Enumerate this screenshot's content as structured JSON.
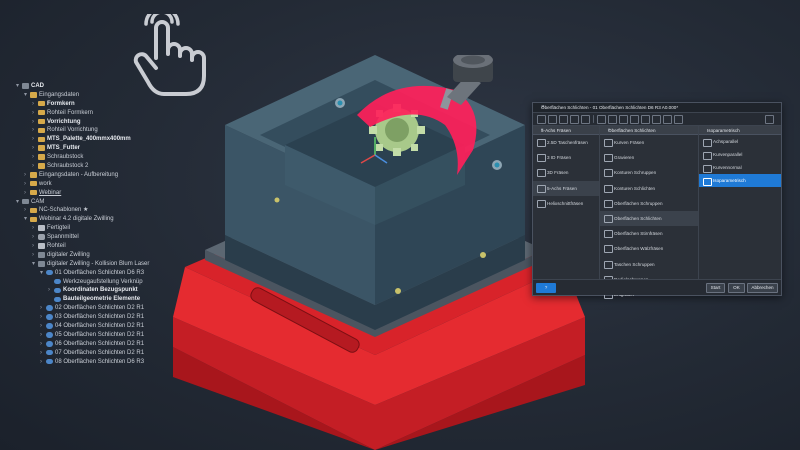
{
  "tree": {
    "rows": [
      {
        "caret": "▾",
        "indent": 0,
        "icon": "cam",
        "label": "CAD",
        "bold": true
      },
      {
        "caret": "▾",
        "indent": 1,
        "icon": "folder",
        "label": "Eingangsdaten"
      },
      {
        "caret": "›",
        "indent": 2,
        "icon": "folder",
        "label": "Formkern",
        "bold": true
      },
      {
        "caret": "›",
        "indent": 2,
        "icon": "folder",
        "label": "Rohteil Formkern"
      },
      {
        "caret": "›",
        "indent": 2,
        "icon": "folder",
        "label": "Vorrichtung",
        "bold": true
      },
      {
        "caret": "›",
        "indent": 2,
        "icon": "folder",
        "label": "Rohteil Vorrichtung"
      },
      {
        "caret": "›",
        "indent": 2,
        "icon": "folder",
        "label": "MTS_Palette_400mmx400mm",
        "bold": true
      },
      {
        "caret": "›",
        "indent": 2,
        "icon": "folder",
        "label": "MTS_Futter",
        "bold": true
      },
      {
        "caret": "›",
        "indent": 2,
        "icon": "folder",
        "label": "Schraubstock"
      },
      {
        "caret": "›",
        "indent": 2,
        "icon": "folder",
        "label": "Schraubstock 2"
      },
      {
        "caret": "›",
        "indent": 1,
        "icon": "folder",
        "label": "Eingangsdaten - Aufbereitung"
      },
      {
        "caret": "›",
        "indent": 1,
        "icon": "folder",
        "label": "work"
      },
      {
        "caret": "›",
        "indent": 1,
        "icon": "folder",
        "label": "Webinar",
        "underline": true
      },
      {
        "caret": "▾",
        "indent": 0,
        "icon": "cam",
        "label": "CAM"
      },
      {
        "caret": "›",
        "indent": 1,
        "icon": "folder",
        "label": "NC-Schablonen ★"
      },
      {
        "caret": "▾",
        "indent": 1,
        "icon": "folder",
        "label": "Webinar 4.2 digitale Zwilling"
      },
      {
        "caret": "›",
        "indent": 2,
        "icon": "part",
        "label": "Fertigteil"
      },
      {
        "caret": "›",
        "indent": 2,
        "icon": "cyl",
        "label": "Spannmittel"
      },
      {
        "caret": "›",
        "indent": 2,
        "icon": "part",
        "label": "Rohteil"
      },
      {
        "caret": "›",
        "indent": 2,
        "icon": "cam",
        "label": "digitaler Zwilling"
      },
      {
        "caret": "▾",
        "indent": 2,
        "icon": "cam",
        "label": "digitaler Zwilling - Kollision Blum Laser"
      },
      {
        "caret": "▾",
        "indent": 3,
        "icon": "op",
        "label": "01 Oberflächen Schlichten D6 R3"
      },
      {
        "caret": "",
        "indent": 4,
        "icon": "op",
        "label": "Werkzeugaufstellung Verknüp"
      },
      {
        "caret": "›",
        "indent": 4,
        "icon": "op",
        "label": "Koordinaten Bezugspunkt",
        "bold": true
      },
      {
        "caret": "",
        "indent": 4,
        "icon": "op",
        "label": "Bauteilgeometrie Elemente",
        "bold": true
      },
      {
        "caret": "›",
        "indent": 3,
        "icon": "op",
        "label": "02 Oberflächen Schlichten D2 R1"
      },
      {
        "caret": "›",
        "indent": 3,
        "icon": "op",
        "label": "03 Oberflächen Schlichten D2 R1"
      },
      {
        "caret": "›",
        "indent": 3,
        "icon": "op",
        "label": "04 Oberflächen Schlichten D2 R1"
      },
      {
        "caret": "›",
        "indent": 3,
        "icon": "op",
        "label": "05 Oberflächen Schlichten D2 R1"
      },
      {
        "caret": "›",
        "indent": 3,
        "icon": "op",
        "label": "06 Oberflächen Schlichten D2 R1"
      },
      {
        "caret": "›",
        "indent": 3,
        "icon": "op",
        "label": "07 Oberflächen Schlichten D2 R1"
      },
      {
        "caret": "›",
        "indent": 3,
        "icon": "op",
        "label": "08 Oberflächen Schlichten D6 R3"
      }
    ]
  },
  "dialog": {
    "title": "Oberflächen Schlichten - 01 Oberflächen Schlichten D6 R3 A0.000*",
    "close": "✕",
    "col1": {
      "header": "5-Achs Fräsen",
      "items": [
        "2.5D Taschenfräsen",
        "3 ID Fräsen",
        "3D Fräsen",
        "5-Achs Fräsen",
        "Helixschnittfräsen"
      ],
      "selected_index": 3
    },
    "col2": {
      "header": "Oberflächen Schlichten",
      "items": [
        "Kurven Fräsen",
        "Gravieren",
        "Konturen Schruppen",
        "Konturen Schlichten",
        "Oberflächen Schruppen",
        "Oberflächen Schlichten",
        "Oberflächen Stirnfräsen",
        "Oberflächen Wälzfräsen",
        "Taschen Schruppen",
        "Radialschruppen",
        "Entgraten"
      ],
      "selected_index": 5
    },
    "col3": {
      "header": "Isoparametrisch",
      "items": [
        "Achsparallel",
        "Kurvenparallel",
        "Kurvennormal",
        "Isoparametrisch"
      ],
      "selected_index": 3
    },
    "footer": {
      "help": "?",
      "start": "Start",
      "ok": "OK",
      "cancel": "Abbrechen"
    }
  },
  "colors": {
    "accent": "#1f7ad6",
    "fixture": "#d8232a",
    "toolpath": "#ff1f5a",
    "part": "#3b5566"
  }
}
